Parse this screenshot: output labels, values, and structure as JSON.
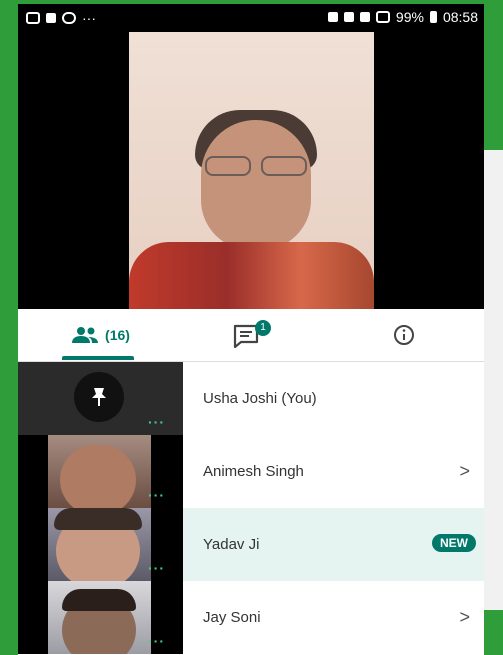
{
  "status_bar": {
    "left_icons": [
      "whatsapp-icon",
      "youtube-icon",
      "link-icon"
    ],
    "more": "···",
    "battery": "99%",
    "time": "08:58"
  },
  "tabs": {
    "people_count": "(16)",
    "chat_badge": "1"
  },
  "participants": [
    {
      "name": "Usha Joshi (You)"
    },
    {
      "name": "Animesh Singh",
      "chevron": ">"
    },
    {
      "name": "Yadav Ji",
      "badge": "NEW"
    },
    {
      "name": "Jay Soni",
      "chevron": ">"
    }
  ],
  "more_label": "···",
  "colors": {
    "accent": "#00796b",
    "highlight": "#e6f4f1",
    "frame": "#2e9d3a"
  }
}
